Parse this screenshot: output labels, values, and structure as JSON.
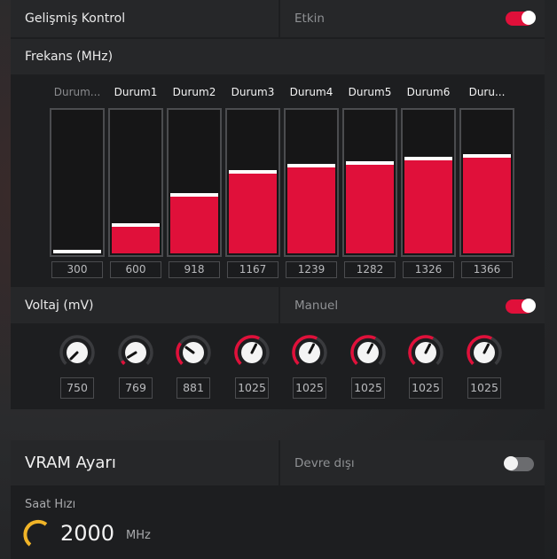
{
  "advanced": {
    "label": "Gelişmiş Kontrol",
    "status": "Etkin",
    "toggle_on": true
  },
  "frequency": {
    "label": "Frekans (MHz)",
    "states": [
      {
        "name": "Durum...",
        "value": "300",
        "level": 0.0,
        "dim": true
      },
      {
        "name": "Durum1",
        "value": "600",
        "level": 0.18
      },
      {
        "name": "Durum2",
        "value": "918",
        "level": 0.39
      },
      {
        "name": "Durum3",
        "value": "1167",
        "level": 0.55
      },
      {
        "name": "Durum4",
        "value": "1239",
        "level": 0.59
      },
      {
        "name": "Durum5",
        "value": "1282",
        "level": 0.61
      },
      {
        "name": "Durum6",
        "value": "1326",
        "level": 0.64
      },
      {
        "name": "Duru...",
        "value": "1366",
        "level": 0.66
      }
    ]
  },
  "voltage": {
    "label": "Voltaj (mV)",
    "mode": "Manuel",
    "toggle_on": true,
    "knobs": [
      {
        "value": "750",
        "level": 0.0
      },
      {
        "value": "769",
        "level": 0.05
      },
      {
        "value": "881",
        "level": 0.3
      },
      {
        "value": "1025",
        "level": 0.6
      },
      {
        "value": "1025",
        "level": 0.6
      },
      {
        "value": "1025",
        "level": 0.6
      },
      {
        "value": "1025",
        "level": 0.6
      },
      {
        "value": "1025",
        "level": 0.6
      }
    ]
  },
  "vram": {
    "title": "VRAM Ayarı",
    "status": "Devre dışı",
    "toggle_on": false,
    "clock_label": "Saat Hızı",
    "clock_value": "2000",
    "clock_unit": "MHz"
  },
  "colors": {
    "accent": "#e0103a",
    "gauge": "#f0b428"
  }
}
